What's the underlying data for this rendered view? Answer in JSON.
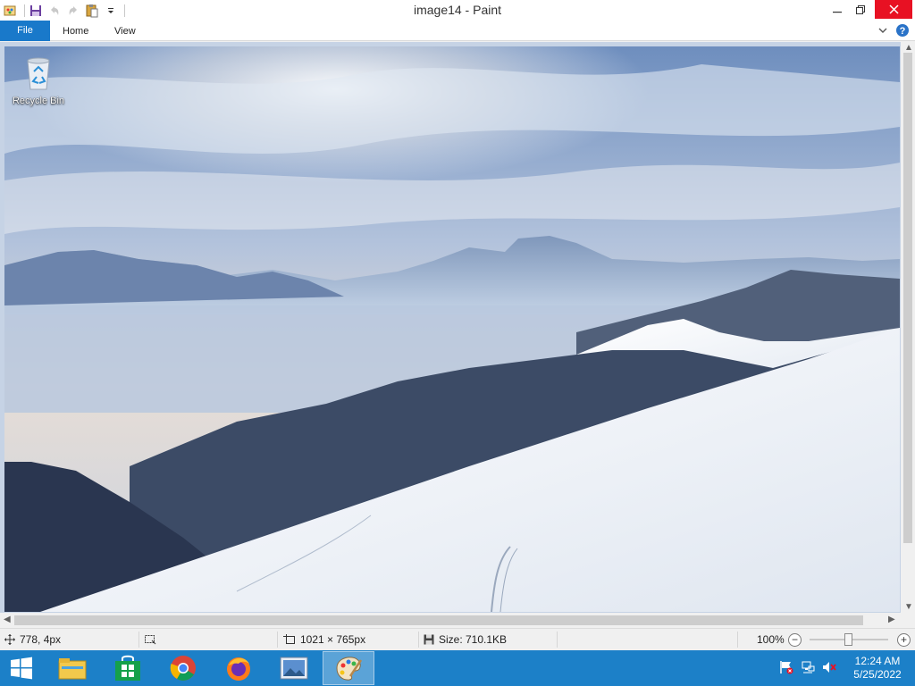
{
  "window": {
    "title": "image14 - Paint",
    "controls": [
      "minimize",
      "restore",
      "close"
    ]
  },
  "quick_access_toolbar": {
    "icons": [
      "paint-app-icon",
      "save-icon",
      "undo-icon",
      "redo-icon",
      "paste-icon",
      "customize-dropdown-icon"
    ]
  },
  "ribbon": {
    "tabs": [
      {
        "label": "File",
        "active": true
      },
      {
        "label": "Home"
      },
      {
        "label": "View"
      }
    ],
    "icons": [
      "collapse-ribbon-icon",
      "help-icon"
    ]
  },
  "desktop": {
    "recycle_bin_label": "Recycle Bin"
  },
  "canvas": {
    "image_description_icon": "snowy-mountain-landscape"
  },
  "statusbar": {
    "cursor_position": "778, 4px",
    "selection_size": "",
    "image_dimensions": "1021 × 765px",
    "file_size": "Size: 710.1KB",
    "zoom_level": "100%",
    "zoom_out": "−",
    "zoom_in": "+"
  },
  "taskbar": {
    "apps": [
      {
        "name": "file-explorer"
      },
      {
        "name": "store"
      },
      {
        "name": "chrome"
      },
      {
        "name": "firefox"
      },
      {
        "name": "photos"
      },
      {
        "name": "paint",
        "active": true
      }
    ],
    "tray_icons": [
      "action-center-flag-icon",
      "network-icon",
      "volume-muted-icon"
    ],
    "time": "12:24 AM",
    "date": "5/25/2022"
  },
  "colors": {
    "accent": "#1979ca",
    "taskbar": "#1c80c8",
    "close": "#e81123"
  }
}
